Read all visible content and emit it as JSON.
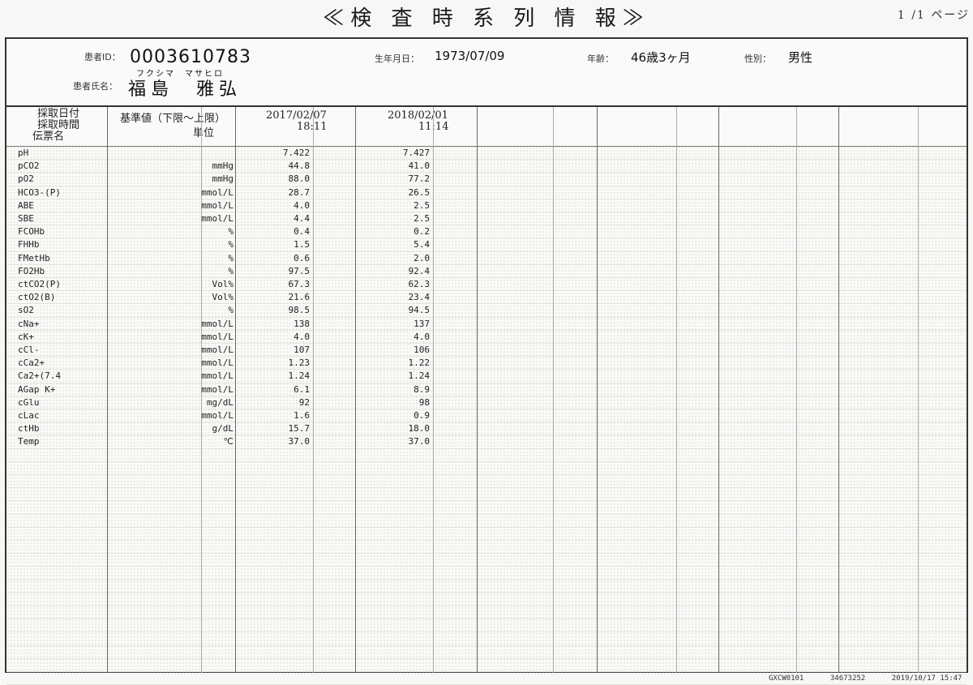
{
  "title": "≪検 査 時 系 列 情 報≫",
  "page_indicator": "1 /1 ページ",
  "patient": {
    "id_label": "患者ID：",
    "id": "0003610783",
    "name_label": "患者氏名：",
    "name": "福島　雅弘",
    "furigana": "フクシマ　マサヒロ",
    "dob_label": "生年月日：",
    "dob": "1973/07/09",
    "age_label": "年齢：",
    "age": "46歳3ヶ月",
    "sex_label": "性別：",
    "sex": "男性"
  },
  "table": {
    "left_header": [
      "採取日付",
      "採取時間",
      "伝票名"
    ],
    "ref_header": "基準値（下限～上限）",
    "unit_header": "単位",
    "dates": [
      {
        "date": "2017/02/07",
        "time": "18:11"
      },
      {
        "date": "2018/02/01",
        "time": "11:14"
      }
    ],
    "rows": [
      {
        "name": "pH",
        "unit": "",
        "v1": "7.422",
        "v2": "7.427"
      },
      {
        "name": "pCO2",
        "unit": "mmHg",
        "v1": "44.8",
        "v2": "41.0"
      },
      {
        "name": "pO2",
        "unit": "mmHg",
        "v1": "88.0",
        "v2": "77.2"
      },
      {
        "name": "HCO3-(P)",
        "unit": "mmol/L",
        "v1": "28.7",
        "v2": "26.5"
      },
      {
        "name": "ABE",
        "unit": "mmol/L",
        "v1": "4.0",
        "v2": "2.5"
      },
      {
        "name": "SBE",
        "unit": "mmol/L",
        "v1": "4.4",
        "v2": "2.5"
      },
      {
        "name": "FCOHb",
        "unit": "%",
        "v1": "0.4",
        "v2": "0.2"
      },
      {
        "name": "FHHb",
        "unit": "%",
        "v1": "1.5",
        "v2": "5.4"
      },
      {
        "name": "FMetHb",
        "unit": "%",
        "v1": "0.6",
        "v2": "2.0"
      },
      {
        "name": "FO2Hb",
        "unit": "%",
        "v1": "97.5",
        "v2": "92.4"
      },
      {
        "name": "ctCO2(P)",
        "unit": "Vol%",
        "v1": "67.3",
        "v2": "62.3"
      },
      {
        "name": "ctO2(B)",
        "unit": "Vol%",
        "v1": "21.6",
        "v2": "23.4"
      },
      {
        "name": "sO2",
        "unit": "%",
        "v1": "98.5",
        "v2": "94.5"
      },
      {
        "name": "cNa+",
        "unit": "mmol/L",
        "v1": "138",
        "v2": "137"
      },
      {
        "name": "cK+",
        "unit": "mmol/L",
        "v1": "4.0",
        "v2": "4.0"
      },
      {
        "name": "cCl-",
        "unit": "mmol/L",
        "v1": "107",
        "v2": "106"
      },
      {
        "name": "cCa2+",
        "unit": "mmol/L",
        "v1": "1.23",
        "v2": "1.22"
      },
      {
        "name": "Ca2+(7.4",
        "unit": "mmol/L",
        "v1": "1.24",
        "v2": "1.24"
      },
      {
        "name": "AGap K+",
        "unit": "mmol/L",
        "v1": "6.1",
        "v2": "8.9"
      },
      {
        "name": "cGlu",
        "unit": "mg/dL",
        "v1": "92",
        "v2": "98"
      },
      {
        "name": "cLac",
        "unit": "mmol/L",
        "v1": "1.6",
        "v2": "0.9"
      },
      {
        "name": "ctHb",
        "unit": "g/dL",
        "v1": "15.7",
        "v2": "18.0"
      },
      {
        "name": "Temp",
        "unit": "℃",
        "v1": "37.0",
        "v2": "37.0"
      }
    ]
  },
  "footer": {
    "code": "GXCW0101",
    "number": "34673252",
    "printed": "2019/10/17 15:47"
  }
}
